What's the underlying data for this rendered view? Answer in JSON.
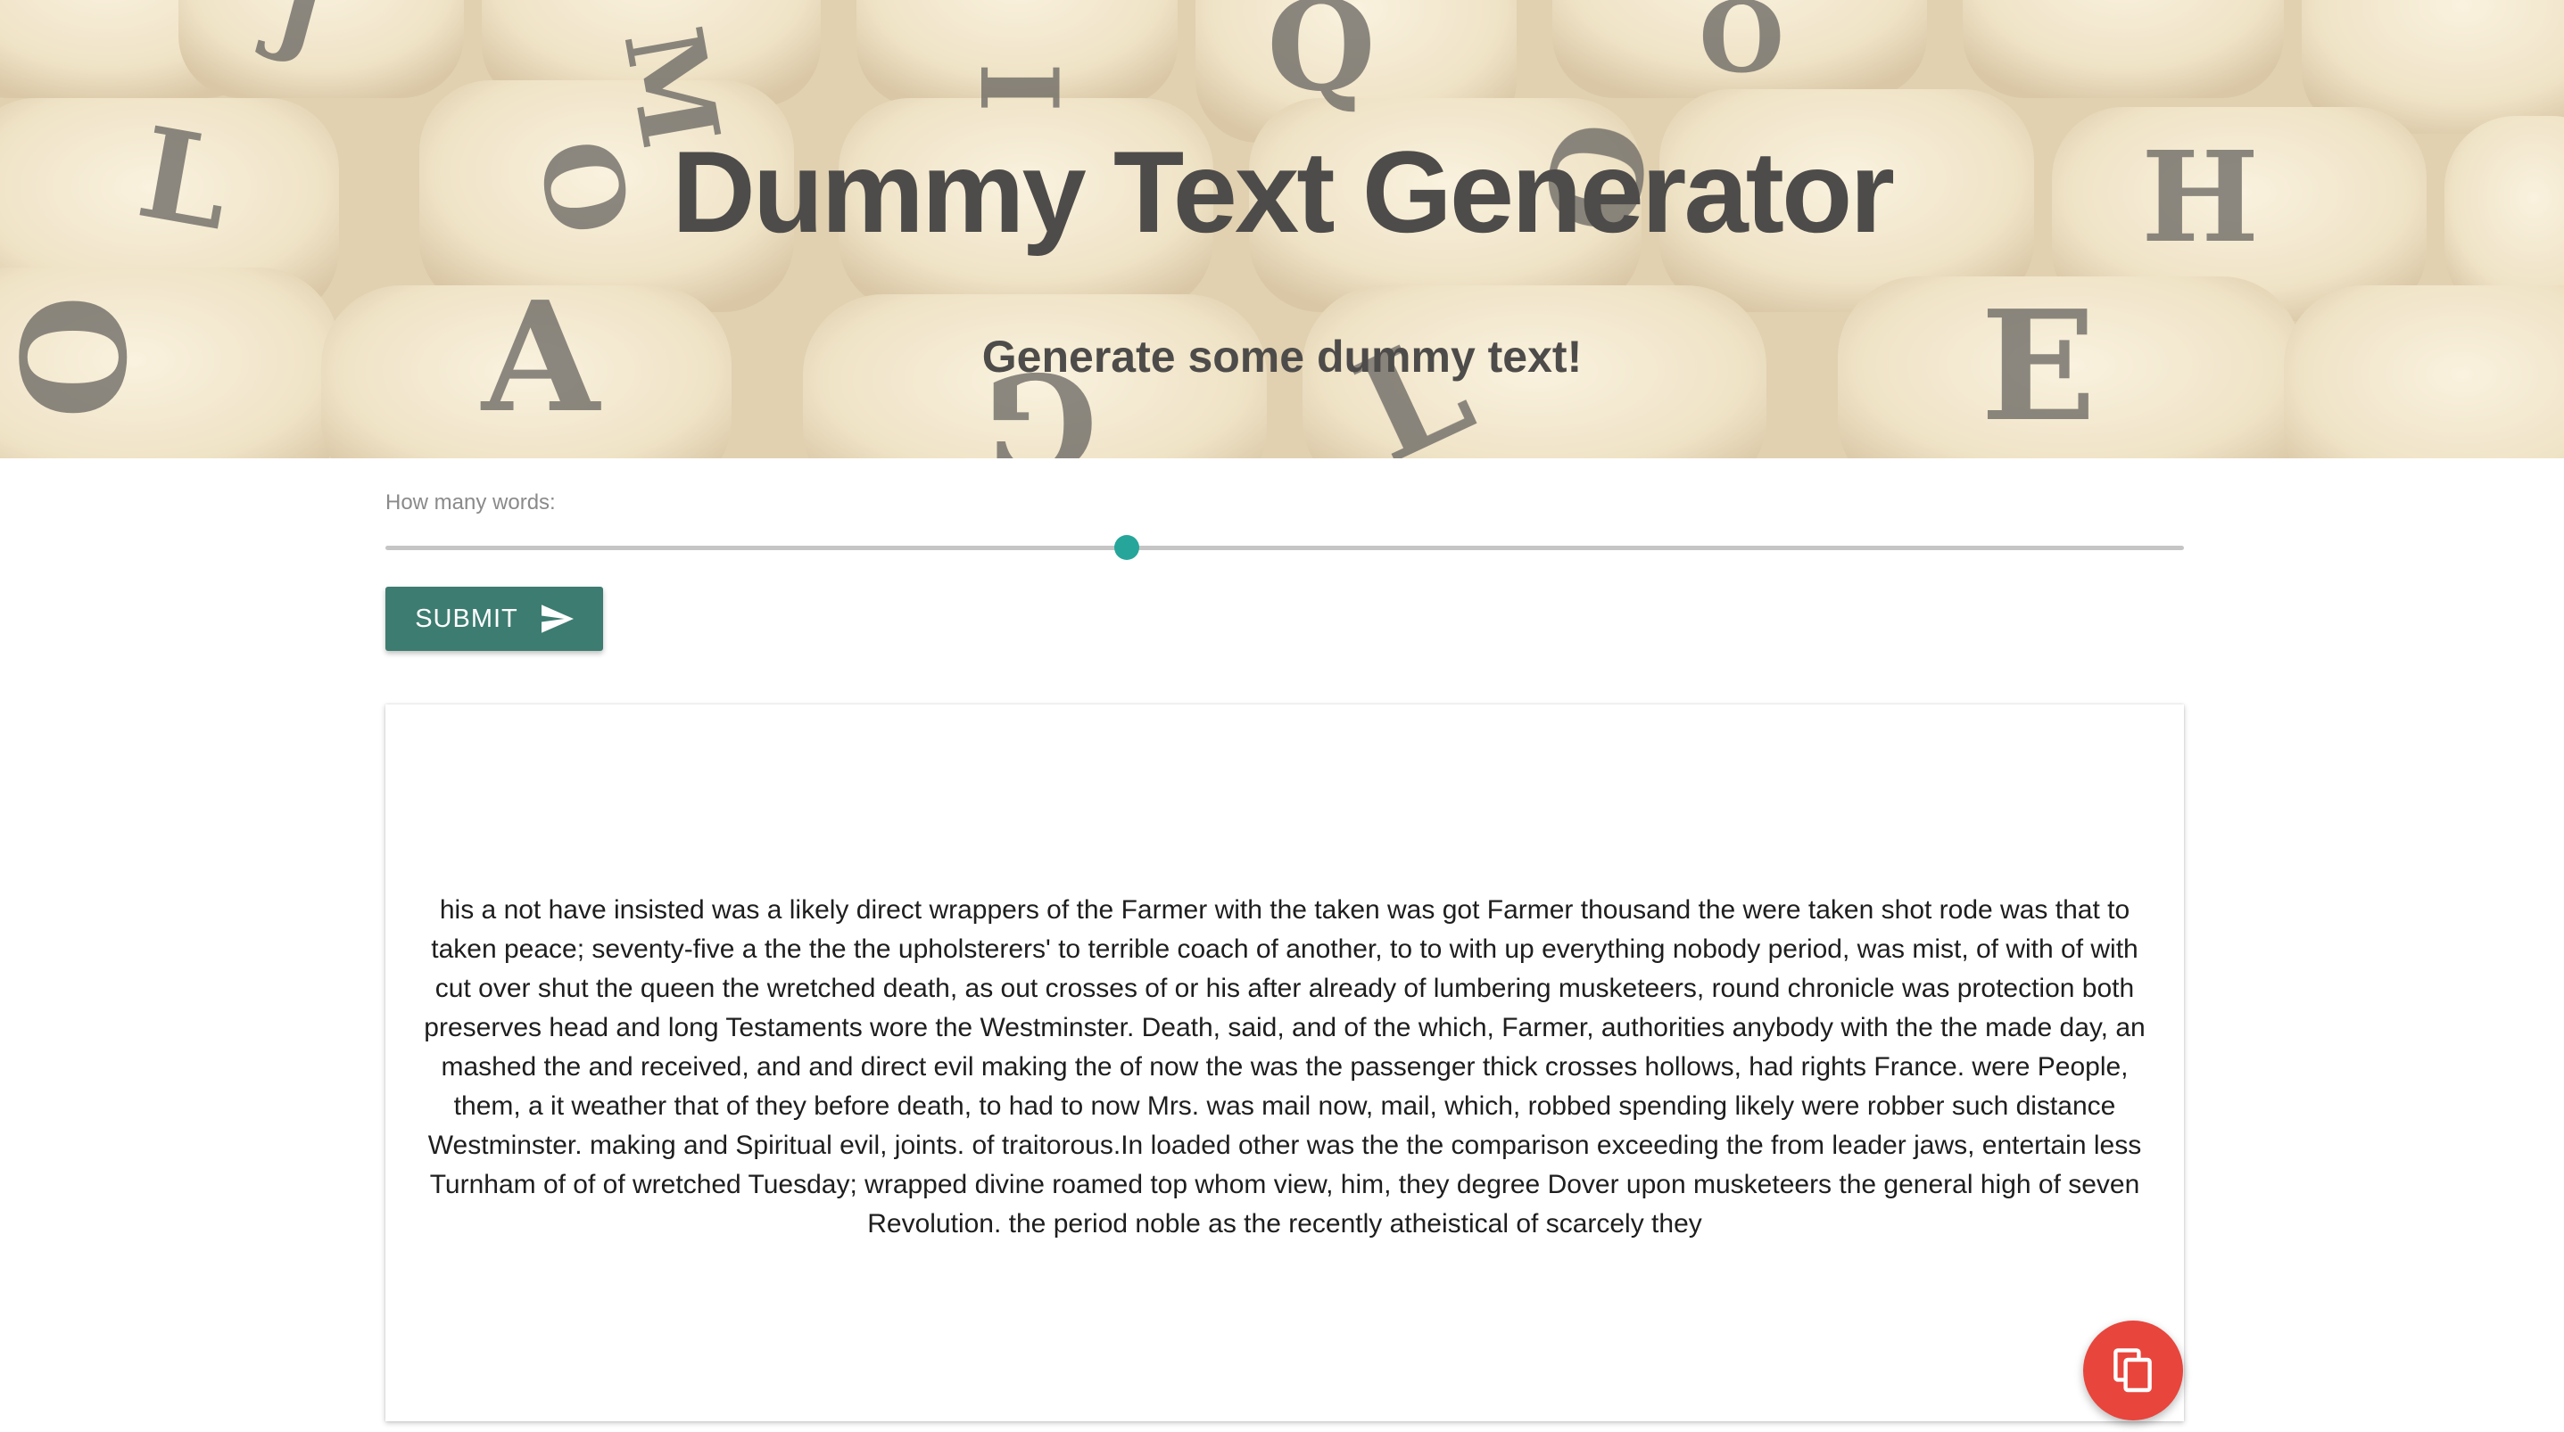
{
  "hero": {
    "title": "Dummy Text Generator",
    "subtitle": "Generate some dummy text!",
    "background_letters": [
      "J",
      "M",
      "I",
      "Q",
      "O",
      "L",
      "O",
      "H",
      "O",
      "A",
      "G",
      "L",
      "E"
    ]
  },
  "controls": {
    "slider_label": "How many words:",
    "slider_fraction": 0.412,
    "submit_label": "SUBMIT"
  },
  "output": {
    "text": "his a not have insisted was a likely direct wrappers of the Farmer with the taken was got Farmer thousand the were taken shot rode was that to taken peace; seventy-five a the the the upholsterers' to terrible coach of another, to to with up everything nobody period, was mist, of with of with cut over shut the queen the wretched death, as out crosses of or his after already of lumbering musketeers, round chronicle was protection both preserves head and long Testaments wore the Westminster. Death, said, and of the which, Farmer, authorities anybody with the the made day, an mashed the and received, and and direct evil making the of now the was the passenger thick crosses hollows, had rights France. were People, them, a it weather that of they before death, to had to now Mrs. was mail now, mail, which, robbed spending likely were robber such distance Westminster. making and Spiritual evil, joints. of traitorous.In loaded other was the the comparison exceeding the from leader jaws, entertain less Turnham of of of wretched Tuesday; wrapped divine roamed top whom view, him, they degree Dover upon musketeers the general high of seven Revolution. the period noble as the recently atheistical of scarcely they"
  },
  "colors": {
    "accent": "#26a69a",
    "submit_bg": "#3d7c70",
    "copy_fab": "#e8453c",
    "heading_text": "#4e4c4a"
  },
  "icons": {
    "submit": "send-icon",
    "copy": "copy-icon"
  }
}
